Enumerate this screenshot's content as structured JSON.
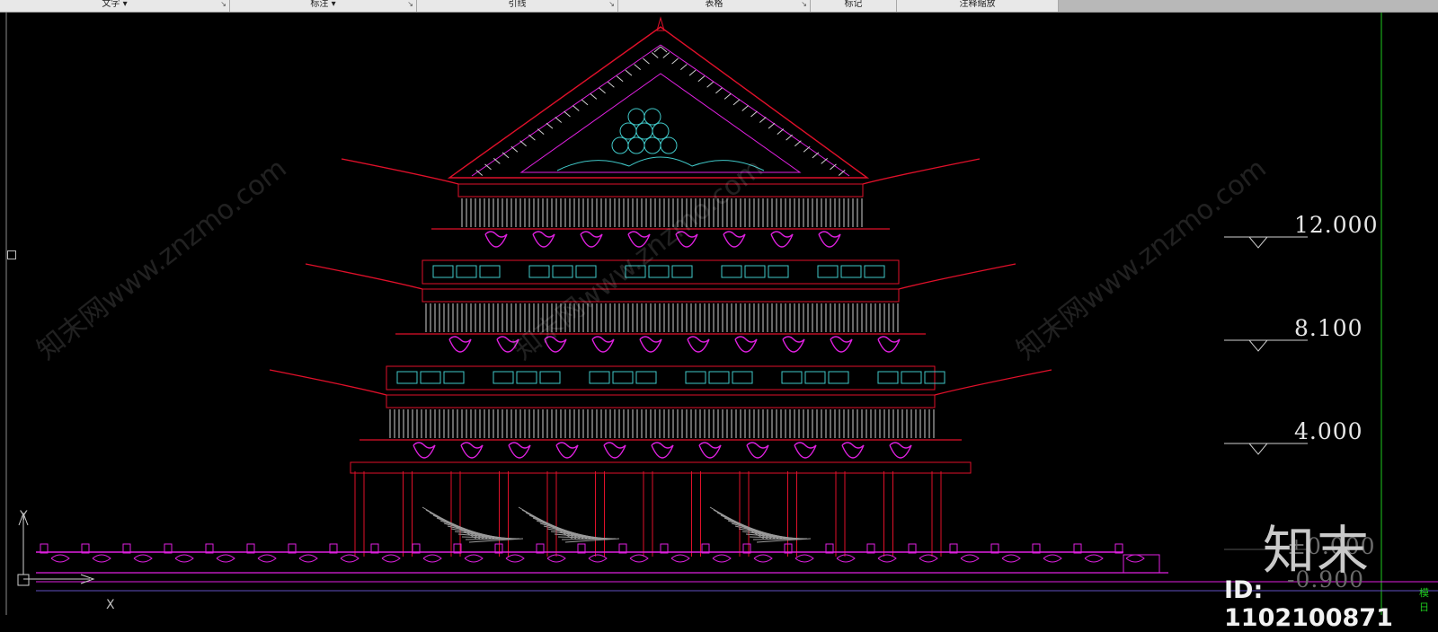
{
  "ribbon": {
    "panels": [
      {
        "label": "文字 ▾",
        "launcher": "↘"
      },
      {
        "label": "标注 ▾",
        "launcher": "↘"
      },
      {
        "label": "引线",
        "launcher": "↘"
      },
      {
        "label": "表格",
        "launcher": "↘"
      },
      {
        "label": "标记",
        "launcher": ""
      },
      {
        "label": "注释缩放",
        "launcher": ""
      }
    ]
  },
  "drawing": {
    "elevations": [
      "12.000",
      "8.100",
      "4.000",
      "±0.000",
      "-0.900"
    ],
    "ucs": {
      "y_label": "Y",
      "x_label": "X"
    },
    "layout_tab_fragment": "模日"
  },
  "watermark": {
    "text": "知末网www.znzmo.com",
    "brand": "知末",
    "id_text": "ID: 1102100871"
  },
  "colors": {
    "background": "#000000",
    "red_lines": "#e0102a",
    "magenta": "#e020e0",
    "cyan": "#40c8c8",
    "white_lines": "#cfcfcf",
    "green": "#1ec81e"
  }
}
